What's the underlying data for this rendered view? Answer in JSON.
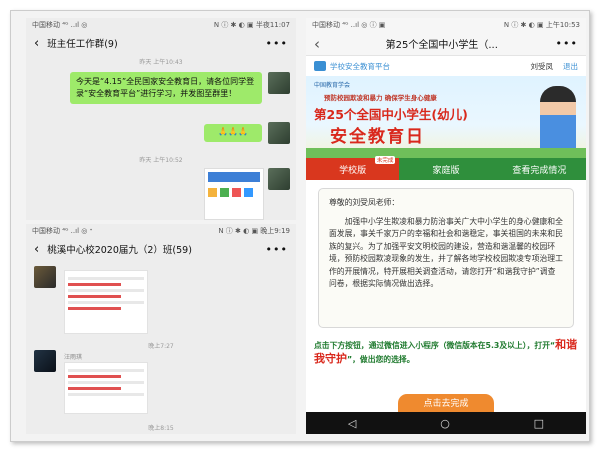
{
  "panel1": {
    "status": {
      "carrier": "中国移动 ⁴ᴳ ..ıl ◎",
      "right": "N ⓘ ✱ ◐ ▣ 半夜11:07"
    },
    "title": "班主任工作群(9)",
    "time1": "昨天 上午10:43",
    "message": "今天是“4.15”全民国家安全教育日，请各位同学登录“安全教育平台”进行学习，并发图至群里！",
    "emoji": "🙏🙏🙏",
    "time2": "昨天 上午10:52"
  },
  "panel2": {
    "status": {
      "carrier": "中国移动 ⁴ᴳ ..ıl ◎ ᐩ",
      "right": "N ⓘ ✱ ◐ ▣ 晚上9:19"
    },
    "title": "桃溪中心校2020届九（2）班(59)",
    "time1": "晚上7:27",
    "sender2": "汪雨琪",
    "time2": "晚上8:15"
  },
  "panel3": {
    "status": {
      "carrier": "中国移动 ⁴ᴳ ..ıl ◎ ⓘ ▣",
      "right": "N ⓘ ✱ ◐ ▣ 上午10:53"
    },
    "title": "第25个全国中小学生（...",
    "platform": "学校安全教育平台",
    "user": "刘受凤",
    "logout": "退出",
    "banner_org": "中国教育学会",
    "banner_slogan": "预防校园欺凌和暴力 确保学生身心健康",
    "banner_title1": "第25个全国中小学生(幼儿)",
    "banner_title2": "安全教育日",
    "tabs": [
      "学校版",
      "家庭版",
      "查看完成情况"
    ],
    "badge": "未完成",
    "greeting": "尊敬的刘受凤老师：",
    "letter": "加强中小学生欺凌和暴力防治事关广大中小学生的身心健康和全面发展，事关千家万户的幸福和社会和谐稳定，事关祖国的未来和民族的复兴。为了加强平安文明校园的建设，营造和谐温馨的校园环境，预防校园欺凌现象的发生，并了解各地学校校园欺凌专项治理工作的开展情况，特开展相关调查活动，请您打开“和谐我守护”调查问卷，根据实际情况做出选择。",
    "cta_prefix": "点击下方按钮，通过微信进入小程序（微信版本在5.3及以上），打开“",
    "cta_highlight": "和谐我守护",
    "cta_suffix": "”，做出您的选择。",
    "button": "点击去完成",
    "nav": [
      "◁",
      "○",
      "□"
    ]
  },
  "colors": {
    "tab_green": "#2f8f3c",
    "tab_red": "#d9371e",
    "bubble": "#9eea6a",
    "button": "#ef8a2f"
  }
}
